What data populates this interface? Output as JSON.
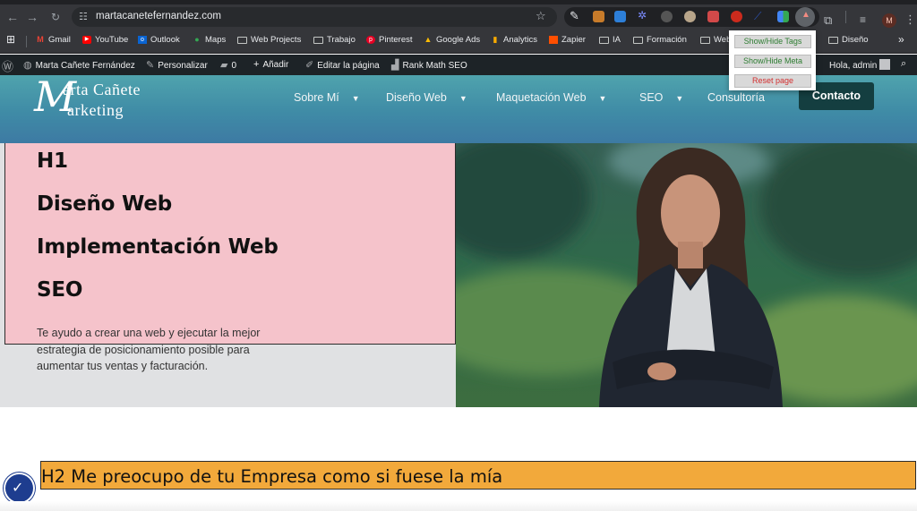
{
  "browser": {
    "url": "martacanetefernandez.com",
    "profile_initial": "M",
    "bookmarks": [
      "Gmail",
      "YouTube",
      "Outlook",
      "Maps",
      "Web Projects",
      "Trabajo",
      "Pinterest",
      "Google Ads",
      "Analytics",
      "Zapier",
      "IA",
      "Formación",
      "Web",
      "Diseño"
    ]
  },
  "popup": {
    "show_tags": "Show/Hide Tags",
    "show_meta": "Show/Hide Meta",
    "reset": "Reset page"
  },
  "adminbar": {
    "site": "Marta Cañete Fernández",
    "customize": "Personalizar",
    "comments": "0",
    "add": "Añadir",
    "edit": "Editar la página",
    "rankmath": "Rank Math SEO",
    "greeting": "Hola, admin"
  },
  "site": {
    "logo_m": "M",
    "logo_line1": "arta Cañete",
    "logo_line2": "arketing",
    "nav": [
      "Sobre Mí",
      "Diseño Web",
      "Maquetación Web",
      "SEO",
      "Consultoría"
    ],
    "contact": "Contacto"
  },
  "hero": {
    "lines": [
      "H1",
      "Diseño Web",
      "Implementación Web",
      "SEO"
    ],
    "description": "Te ayudo a crear una web y ejecutar la mejor estrategia de posicionamiento posible para aumentar tus ventas y facturación."
  },
  "h2": "H2 Me preocupo de tu Empresa como si fuese la mía",
  "colors": {
    "header": "#4a9aab",
    "contact": "#143e40",
    "pink": "#f5c3cb",
    "h2bar": "#f2a93b",
    "a11y": "#1e3d8f"
  }
}
